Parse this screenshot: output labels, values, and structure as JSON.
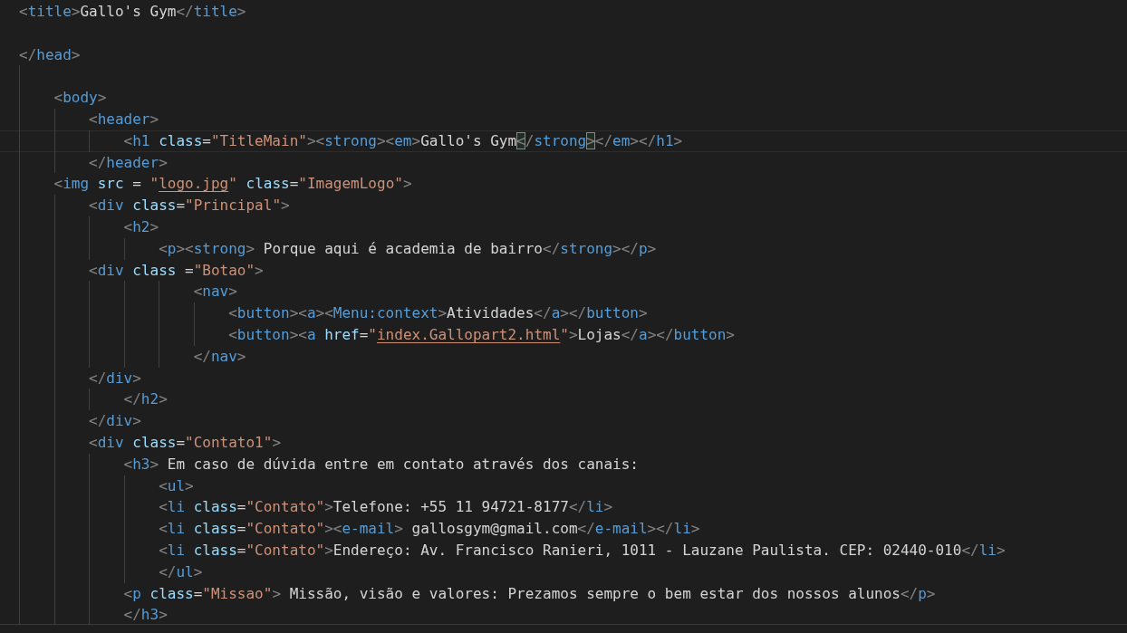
{
  "editor": {
    "lines": [
      {
        "kind": "code",
        "current": false,
        "tokens": [
          {
            "text": "<",
            "kind": "punct"
          },
          {
            "text": "title",
            "kind": "tag"
          },
          {
            "text": ">",
            "kind": "punct"
          },
          {
            "text": "Gallo's Gym",
            "kind": "text"
          },
          {
            "text": "</",
            "kind": "punct"
          },
          {
            "text": "title",
            "kind": "tag"
          },
          {
            "text": ">",
            "kind": "punct"
          }
        ]
      },
      {
        "kind": "blank"
      },
      {
        "kind": "code",
        "current": false,
        "tokens": [
          {
            "text": "</",
            "kind": "punct"
          },
          {
            "text": "head",
            "kind": "tag"
          },
          {
            "text": ">",
            "kind": "punct"
          }
        ]
      },
      {
        "kind": "blank"
      },
      {
        "kind": "code",
        "current": false,
        "tokens": [
          {
            "text": "    <",
            "kind": "punct"
          },
          {
            "text": "body",
            "kind": "tag"
          },
          {
            "text": ">",
            "kind": "punct"
          }
        ]
      },
      {
        "kind": "code",
        "current": false,
        "tokens": [
          {
            "text": "        <",
            "kind": "punct"
          },
          {
            "text": "header",
            "kind": "tag"
          },
          {
            "text": ">",
            "kind": "punct"
          }
        ]
      },
      {
        "kind": "code",
        "current": true,
        "tokens": [
          {
            "text": "            <",
            "kind": "punct"
          },
          {
            "text": "h1",
            "kind": "tag"
          },
          {
            "text": " class",
            "kind": "attr"
          },
          {
            "text": "=",
            "kind": "text"
          },
          {
            "text": "\"TitleMain\"",
            "kind": "string"
          },
          {
            "text": "><",
            "kind": "punct"
          },
          {
            "text": "strong",
            "kind": "tag"
          },
          {
            "text": "><",
            "kind": "punct"
          },
          {
            "text": "em",
            "kind": "tag"
          },
          {
            "text": ">",
            "kind": "punct"
          },
          {
            "text": "Gallo's Gym",
            "kind": "text"
          },
          {
            "text": "<",
            "kind": "bracket-match"
          },
          {
            "text": "/",
            "kind": "punct"
          },
          {
            "text": "strong",
            "kind": "tag"
          },
          {
            "text": ">",
            "kind": "bracket-match"
          },
          {
            "text": "</",
            "kind": "punct"
          },
          {
            "text": "em",
            "kind": "tag"
          },
          {
            "text": "></",
            "kind": "punct"
          },
          {
            "text": "h1",
            "kind": "tag"
          },
          {
            "text": ">",
            "kind": "punct"
          }
        ]
      },
      {
        "kind": "code",
        "current": false,
        "tokens": [
          {
            "text": "        </",
            "kind": "punct"
          },
          {
            "text": "header",
            "kind": "tag"
          },
          {
            "text": ">",
            "kind": "punct"
          }
        ]
      },
      {
        "kind": "code",
        "current": false,
        "tokens": [
          {
            "text": "    <",
            "kind": "punct"
          },
          {
            "text": "img",
            "kind": "tag"
          },
          {
            "text": " src",
            "kind": "attr"
          },
          {
            "text": " = ",
            "kind": "text"
          },
          {
            "text": "\"",
            "kind": "string"
          },
          {
            "text": "logo.jpg",
            "kind": "link"
          },
          {
            "text": "\"",
            "kind": "string"
          },
          {
            "text": " class",
            "kind": "attr"
          },
          {
            "text": "=",
            "kind": "text"
          },
          {
            "text": "\"ImagemLogo\"",
            "kind": "string"
          },
          {
            "text": ">",
            "kind": "punct"
          }
        ]
      },
      {
        "kind": "code",
        "current": false,
        "tokens": [
          {
            "text": "        <",
            "kind": "punct"
          },
          {
            "text": "div",
            "kind": "tag"
          },
          {
            "text": " class",
            "kind": "attr"
          },
          {
            "text": "=",
            "kind": "text"
          },
          {
            "text": "\"Principal\"",
            "kind": "string"
          },
          {
            "text": ">",
            "kind": "punct"
          }
        ]
      },
      {
        "kind": "code",
        "current": false,
        "tokens": [
          {
            "text": "            <",
            "kind": "punct"
          },
          {
            "text": "h2",
            "kind": "tag"
          },
          {
            "text": ">",
            "kind": "punct"
          }
        ]
      },
      {
        "kind": "code",
        "current": false,
        "tokens": [
          {
            "text": "                <",
            "kind": "punct"
          },
          {
            "text": "p",
            "kind": "tag"
          },
          {
            "text": "><",
            "kind": "punct"
          },
          {
            "text": "strong",
            "kind": "tag"
          },
          {
            "text": ">",
            "kind": "punct"
          },
          {
            "text": " Porque aqui é academia de bairro",
            "kind": "text"
          },
          {
            "text": "</",
            "kind": "punct"
          },
          {
            "text": "strong",
            "kind": "tag"
          },
          {
            "text": "></",
            "kind": "punct"
          },
          {
            "text": "p",
            "kind": "tag"
          },
          {
            "text": ">",
            "kind": "punct"
          }
        ]
      },
      {
        "kind": "code",
        "current": false,
        "tokens": [
          {
            "text": "        <",
            "kind": "punct"
          },
          {
            "text": "div",
            "kind": "tag"
          },
          {
            "text": " class",
            "kind": "attr"
          },
          {
            "text": " =",
            "kind": "text"
          },
          {
            "text": "\"Botao\"",
            "kind": "string"
          },
          {
            "text": ">",
            "kind": "punct"
          }
        ]
      },
      {
        "kind": "code",
        "current": false,
        "tokens": [
          {
            "text": "                    <",
            "kind": "punct"
          },
          {
            "text": "nav",
            "kind": "tag"
          },
          {
            "text": ">",
            "kind": "punct"
          }
        ]
      },
      {
        "kind": "code",
        "current": false,
        "tokens": [
          {
            "text": "                        <",
            "kind": "punct"
          },
          {
            "text": "button",
            "kind": "tag"
          },
          {
            "text": "><",
            "kind": "punct"
          },
          {
            "text": "a",
            "kind": "tag"
          },
          {
            "text": "><",
            "kind": "punct"
          },
          {
            "text": "Menu:context",
            "kind": "tag"
          },
          {
            "text": ">",
            "kind": "punct"
          },
          {
            "text": "Atividades",
            "kind": "text"
          },
          {
            "text": "</",
            "kind": "punct"
          },
          {
            "text": "a",
            "kind": "tag"
          },
          {
            "text": "></",
            "kind": "punct"
          },
          {
            "text": "button",
            "kind": "tag"
          },
          {
            "text": ">",
            "kind": "punct"
          }
        ]
      },
      {
        "kind": "code",
        "current": false,
        "tokens": [
          {
            "text": "                        <",
            "kind": "punct"
          },
          {
            "text": "button",
            "kind": "tag"
          },
          {
            "text": "><",
            "kind": "punct"
          },
          {
            "text": "a",
            "kind": "tag"
          },
          {
            "text": " href",
            "kind": "attr"
          },
          {
            "text": "=",
            "kind": "text"
          },
          {
            "text": "\"",
            "kind": "string"
          },
          {
            "text": "index.Gallopart2.html",
            "kind": "link"
          },
          {
            "text": "\"",
            "kind": "string"
          },
          {
            "text": ">",
            "kind": "punct"
          },
          {
            "text": "Lojas",
            "kind": "text"
          },
          {
            "text": "</",
            "kind": "punct"
          },
          {
            "text": "a",
            "kind": "tag"
          },
          {
            "text": "></",
            "kind": "punct"
          },
          {
            "text": "button",
            "kind": "tag"
          },
          {
            "text": ">",
            "kind": "punct"
          }
        ]
      },
      {
        "kind": "code",
        "current": false,
        "tokens": [
          {
            "text": "                    </",
            "kind": "punct"
          },
          {
            "text": "nav",
            "kind": "tag"
          },
          {
            "text": ">",
            "kind": "punct"
          }
        ]
      },
      {
        "kind": "code",
        "current": false,
        "tokens": [
          {
            "text": "        </",
            "kind": "punct"
          },
          {
            "text": "div",
            "kind": "tag"
          },
          {
            "text": ">",
            "kind": "punct"
          }
        ]
      },
      {
        "kind": "code",
        "current": false,
        "tokens": [
          {
            "text": "            </",
            "kind": "punct"
          },
          {
            "text": "h2",
            "kind": "tag"
          },
          {
            "text": ">",
            "kind": "punct"
          }
        ]
      },
      {
        "kind": "code",
        "current": false,
        "tokens": [
          {
            "text": "        </",
            "kind": "punct"
          },
          {
            "text": "div",
            "kind": "tag"
          },
          {
            "text": ">",
            "kind": "punct"
          }
        ]
      },
      {
        "kind": "code",
        "current": false,
        "tokens": [
          {
            "text": "        <",
            "kind": "punct"
          },
          {
            "text": "div",
            "kind": "tag"
          },
          {
            "text": " class",
            "kind": "attr"
          },
          {
            "text": "=",
            "kind": "text"
          },
          {
            "text": "\"Contato1\"",
            "kind": "string"
          },
          {
            "text": ">",
            "kind": "punct"
          }
        ]
      },
      {
        "kind": "code",
        "current": false,
        "tokens": [
          {
            "text": "            <",
            "kind": "punct"
          },
          {
            "text": "h3",
            "kind": "tag"
          },
          {
            "text": ">",
            "kind": "punct"
          },
          {
            "text": " Em caso de dúvida entre em contato através dos canais:",
            "kind": "text"
          }
        ]
      },
      {
        "kind": "code",
        "current": false,
        "tokens": [
          {
            "text": "                <",
            "kind": "punct"
          },
          {
            "text": "ul",
            "kind": "tag"
          },
          {
            "text": ">",
            "kind": "punct"
          }
        ]
      },
      {
        "kind": "code",
        "current": false,
        "tokens": [
          {
            "text": "                <",
            "kind": "punct"
          },
          {
            "text": "li",
            "kind": "tag"
          },
          {
            "text": " class",
            "kind": "attr"
          },
          {
            "text": "=",
            "kind": "text"
          },
          {
            "text": "\"Contato\"",
            "kind": "string"
          },
          {
            "text": ">",
            "kind": "punct"
          },
          {
            "text": "Telefone: +55 11 94721-8177",
            "kind": "text"
          },
          {
            "text": "</",
            "kind": "punct"
          },
          {
            "text": "li",
            "kind": "tag"
          },
          {
            "text": ">",
            "kind": "punct"
          }
        ]
      },
      {
        "kind": "code",
        "current": false,
        "tokens": [
          {
            "text": "                <",
            "kind": "punct"
          },
          {
            "text": "li",
            "kind": "tag"
          },
          {
            "text": " class",
            "kind": "attr"
          },
          {
            "text": "=",
            "kind": "text"
          },
          {
            "text": "\"Contato\"",
            "kind": "string"
          },
          {
            "text": "><",
            "kind": "punct"
          },
          {
            "text": "e-mail",
            "kind": "tag"
          },
          {
            "text": ">",
            "kind": "punct"
          },
          {
            "text": " gallosgym@gmail.com",
            "kind": "text"
          },
          {
            "text": "</",
            "kind": "punct"
          },
          {
            "text": "e-mail",
            "kind": "tag"
          },
          {
            "text": "></",
            "kind": "punct"
          },
          {
            "text": "li",
            "kind": "tag"
          },
          {
            "text": ">",
            "kind": "punct"
          }
        ]
      },
      {
        "kind": "code",
        "current": false,
        "tokens": [
          {
            "text": "                <",
            "kind": "punct"
          },
          {
            "text": "li",
            "kind": "tag"
          },
          {
            "text": " class",
            "kind": "attr"
          },
          {
            "text": "=",
            "kind": "text"
          },
          {
            "text": "\"Contato\"",
            "kind": "string"
          },
          {
            "text": ">",
            "kind": "punct"
          },
          {
            "text": "Endereço: Av. Francisco Ranieri, 1011 - Lauzane Paulista. CEP: 02440-010",
            "kind": "text"
          },
          {
            "text": "</",
            "kind": "punct"
          },
          {
            "text": "li",
            "kind": "tag"
          },
          {
            "text": ">",
            "kind": "punct"
          }
        ]
      },
      {
        "kind": "code",
        "current": false,
        "tokens": [
          {
            "text": "                </",
            "kind": "punct"
          },
          {
            "text": "ul",
            "kind": "tag"
          },
          {
            "text": ">",
            "kind": "punct"
          }
        ]
      },
      {
        "kind": "code",
        "current": false,
        "tokens": [
          {
            "text": "            <",
            "kind": "punct"
          },
          {
            "text": "p",
            "kind": "tag"
          },
          {
            "text": " class",
            "kind": "attr"
          },
          {
            "text": "=",
            "kind": "text"
          },
          {
            "text": "\"Missao\"",
            "kind": "string"
          },
          {
            "text": ">",
            "kind": "punct"
          },
          {
            "text": " Missão, visão e valores: Prezamos sempre o bem estar dos nossos alunos",
            "kind": "text"
          },
          {
            "text": "</",
            "kind": "punct"
          },
          {
            "text": "p",
            "kind": "tag"
          },
          {
            "text": ">",
            "kind": "punct"
          }
        ]
      },
      {
        "kind": "code",
        "current": false,
        "tokens": [
          {
            "text": "            </",
            "kind": "punct"
          },
          {
            "text": "h3",
            "kind": "tag"
          },
          {
            "text": ">",
            "kind": "punct"
          }
        ]
      }
    ]
  }
}
